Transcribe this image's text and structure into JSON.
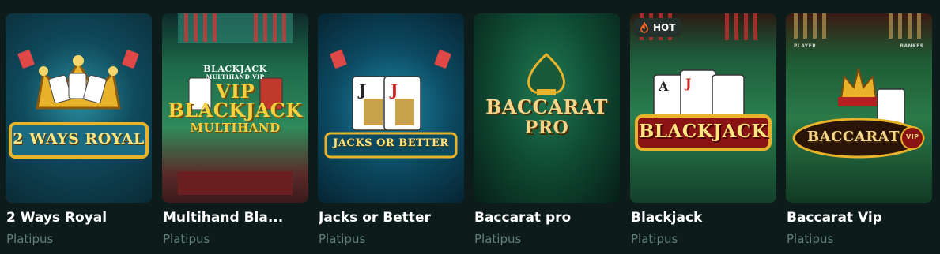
{
  "games": [
    {
      "title": "2 Ways Royal",
      "provider": "Platipus",
      "logo_text": "2 WAYS ROYAL"
    },
    {
      "title": "Multihand Bla...",
      "provider": "Platipus",
      "logo_top": "BLACKJACK",
      "logo_sub": "MULTIHAND VIP",
      "logo_vip": "VIP",
      "logo_main": "BLACKJACK",
      "logo_bottom": "MULTIHAND"
    },
    {
      "title": "Jacks or Better",
      "provider": "Platipus",
      "logo_text": "JACKS OR BETTER"
    },
    {
      "title": "Baccarat pro",
      "provider": "Platipus",
      "logo_main": "BACCARAT",
      "logo_sub": "PRO"
    },
    {
      "title": "Blackjack",
      "provider": "Platipus",
      "badge": "HOT",
      "logo_text": "BLACKJACK"
    },
    {
      "title": "Baccarat Vip",
      "provider": "Platipus",
      "logo_text": "BACCARAT",
      "logo_vip": "VIP",
      "felt_left": "PLAYER",
      "felt_right": "BANKER"
    }
  ]
}
